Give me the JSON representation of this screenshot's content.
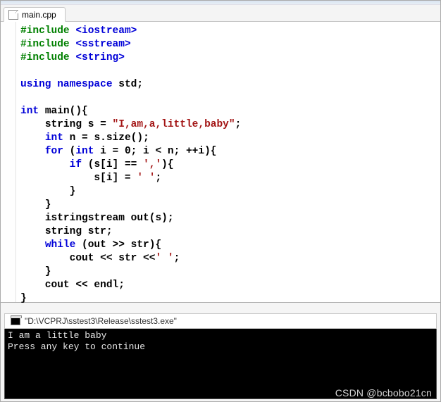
{
  "tab": {
    "filename": "main.cpp"
  },
  "code": {
    "include_iostream": {
      "pp": "#include",
      "ang1": "<",
      "hdr": "iostream",
      "ang2": ">"
    },
    "include_sstream": {
      "pp": "#include",
      "ang1": "<",
      "hdr": "sstream",
      "ang2": ">"
    },
    "include_string": {
      "pp": "#include",
      "ang1": "<",
      "hdr": "string",
      "ang2": ">"
    },
    "using_kw": "using",
    "namespace_kw": "namespace",
    "std_id": "std",
    "int_kw": "int",
    "main_id": "main",
    "string_id": "string",
    "s_id": "s",
    "s_literal": "\"I,am,a,little,baby\"",
    "int_kw2": "int",
    "n_id": "n",
    "size_call": "s.size()",
    "for_kw": "for",
    "int_kw3": "int",
    "i_id": "i",
    "zero": "0",
    "lt": "<",
    "inc": "++i",
    "if_kw": "if",
    "si": "s[i]",
    "eqeq": "==",
    "comma_char": "','",
    "space_char": "' '",
    "istringstream_id": "istringstream",
    "out_id": "out",
    "string_id2": "string",
    "str_id": "str",
    "while_kw": "while",
    "out_expr": "out >> str",
    "cout_id": "cout",
    "cout_str": "str",
    "space_char2": "' '",
    "endl_id": "endl"
  },
  "console": {
    "title": "\"D:\\VCPRJ\\sstest3\\Release\\sstest3.exe\"",
    "line1": "I am a little baby",
    "line2": "Press any key to continue"
  },
  "watermark": "CSDN @bcbobo21cn"
}
